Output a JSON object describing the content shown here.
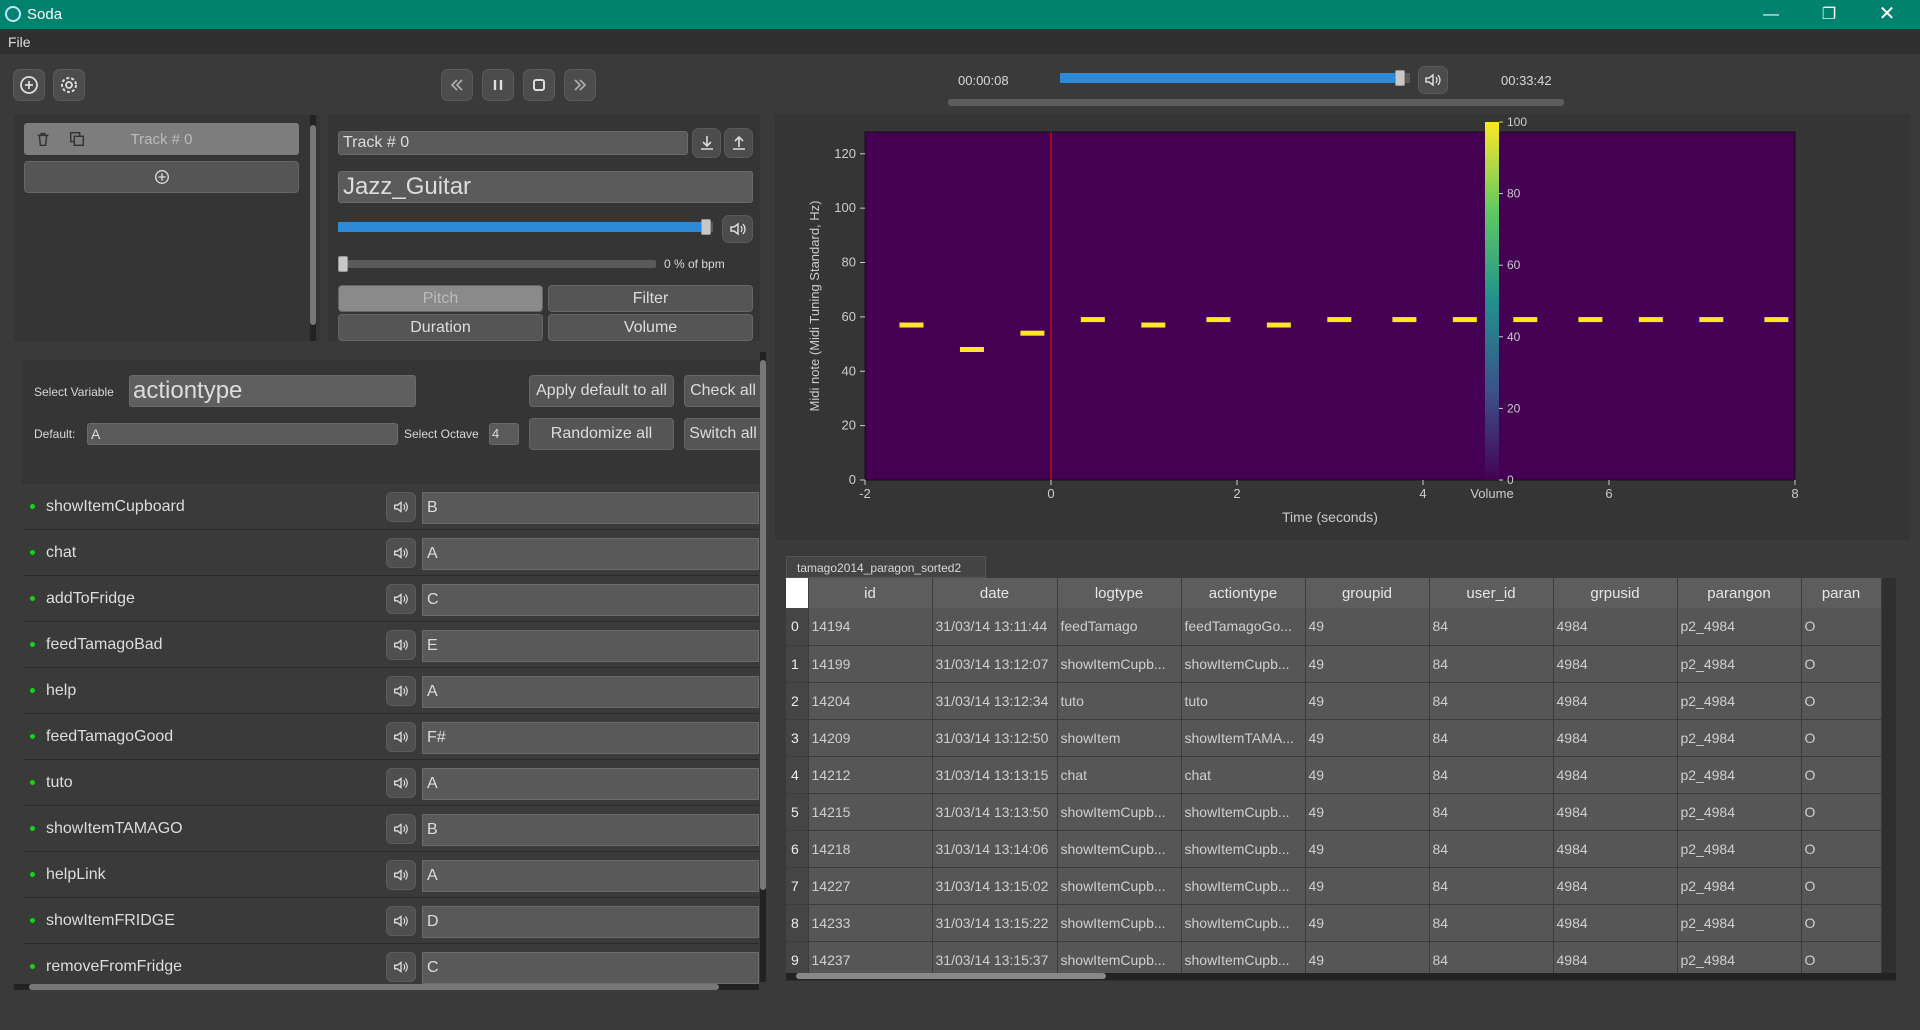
{
  "app": {
    "title": "Soda"
  },
  "menu": {
    "file": "File"
  },
  "transport": {
    "time_current": "00:00:08",
    "time_total": "00:33:42",
    "progress_fraction": 0.98
  },
  "tracks": {
    "items": [
      {
        "label": "Track # 0"
      }
    ]
  },
  "track_editor": {
    "track_name": "Track # 0",
    "instrument": "Jazz_Guitar",
    "volume_fraction": 0.99,
    "bpm_fraction": 0.0,
    "bpm_label": "0 % of bpm",
    "tabs": {
      "pitch": "Pitch",
      "filter": "Filter",
      "duration": "Duration",
      "volume": "Volume"
    }
  },
  "mapping": {
    "select_variable_label": "Select Variable",
    "select_variable_value": "actiontype",
    "default_label": "Default:",
    "default_value": "A",
    "select_octave_label": "Select Octave",
    "octave_value": "4",
    "apply_default_all": "Apply default to all",
    "check_all": "Check all",
    "randomize_all": "Randomize all",
    "switch_all": "Switch all",
    "rows": [
      {
        "label": "showItemCupboard",
        "value": "B"
      },
      {
        "label": "chat",
        "value": "A"
      },
      {
        "label": "addToFridge",
        "value": "C"
      },
      {
        "label": "feedTamagoBad",
        "value": "E"
      },
      {
        "label": "help",
        "value": "A"
      },
      {
        "label": "feedTamagoGood",
        "value": "F#"
      },
      {
        "label": "tuto",
        "value": "A"
      },
      {
        "label": "showItemTAMAGO",
        "value": "B"
      },
      {
        "label": "helpLink",
        "value": "A"
      },
      {
        "label": "showItemFRIDGE",
        "value": "D"
      },
      {
        "label": "removeFromFridge",
        "value": "C"
      }
    ]
  },
  "chart_data": {
    "type": "heatmap",
    "xlabel": "Time (seconds)",
    "ylabel": "Midi note (Midi Tuning Standard, Hz)",
    "xlim": [
      -2,
      8
    ],
    "ylim": [
      0,
      128
    ],
    "xticks": [
      "-2",
      "0",
      "2",
      "4",
      "6",
      "8"
    ],
    "yticks": [
      "0",
      "20",
      "40",
      "60",
      "80",
      "100",
      "120"
    ],
    "playhead_x": 0,
    "colorbar": {
      "label": "Volume",
      "ticks": [
        "0",
        "20",
        "40",
        "60",
        "80",
        "100"
      ],
      "range": [
        0,
        100
      ]
    },
    "colors": {
      "background": "#440154",
      "note": "#fde725",
      "playhead": "#b01010"
    },
    "notes": [
      {
        "t": -1.5,
        "pitch": 57,
        "volume": 100
      },
      {
        "t": -0.85,
        "pitch": 48,
        "volume": 100
      },
      {
        "t": -0.2,
        "pitch": 54,
        "volume": 100
      },
      {
        "t": 0.45,
        "pitch": 59,
        "volume": 100
      },
      {
        "t": 1.1,
        "pitch": 57,
        "volume": 100
      },
      {
        "t": 1.8,
        "pitch": 59,
        "volume": 100
      },
      {
        "t": 2.45,
        "pitch": 57,
        "volume": 100
      },
      {
        "t": 3.1,
        "pitch": 59,
        "volume": 100
      },
      {
        "t": 3.8,
        "pitch": 59,
        "volume": 100
      },
      {
        "t": 4.45,
        "pitch": 59,
        "volume": 100
      },
      {
        "t": 5.1,
        "pitch": 59,
        "volume": 100
      },
      {
        "t": 5.8,
        "pitch": 59,
        "volume": 100
      },
      {
        "t": 6.45,
        "pitch": 59,
        "volume": 100
      },
      {
        "t": 7.1,
        "pitch": 59,
        "volume": 100
      },
      {
        "t": 7.8,
        "pitch": 59,
        "volume": 100
      }
    ]
  },
  "dataset": {
    "tab": "tamago2014_paragon_sorted2",
    "columns": [
      "id",
      "date",
      "logtype",
      "actiontype",
      "groupid",
      "user_id",
      "grpusid",
      "parangon",
      "paran"
    ],
    "rows": [
      [
        "0",
        "14194",
        "31/03/14 13:11:44",
        "feedTamago",
        "feedTamagoGo...",
        "49",
        "84",
        "4984",
        "p2_4984",
        "O"
      ],
      [
        "1",
        "14199",
        "31/03/14 13:12:07",
        "showItemCupb...",
        "showItemCupb...",
        "49",
        "84",
        "4984",
        "p2_4984",
        "O"
      ],
      [
        "2",
        "14204",
        "31/03/14 13:12:34",
        "tuto",
        "tuto",
        "49",
        "84",
        "4984",
        "p2_4984",
        "O"
      ],
      [
        "3",
        "14209",
        "31/03/14 13:12:50",
        "showItem",
        "showItemTAMA...",
        "49",
        "84",
        "4984",
        "p2_4984",
        "O"
      ],
      [
        "4",
        "14212",
        "31/03/14 13:13:15",
        "chat",
        "chat",
        "49",
        "84",
        "4984",
        "p2_4984",
        "O"
      ],
      [
        "5",
        "14215",
        "31/03/14 13:13:50",
        "showItemCupb...",
        "showItemCupb...",
        "49",
        "84",
        "4984",
        "p2_4984",
        "O"
      ],
      [
        "6",
        "14218",
        "31/03/14 13:14:06",
        "showItemCupb...",
        "showItemCupb...",
        "49",
        "84",
        "4984",
        "p2_4984",
        "O"
      ],
      [
        "7",
        "14227",
        "31/03/14 13:15:02",
        "showItemCupb...",
        "showItemCupb...",
        "49",
        "84",
        "4984",
        "p2_4984",
        "O"
      ],
      [
        "8",
        "14233",
        "31/03/14 13:15:22",
        "showItemCupb...",
        "showItemCupb...",
        "49",
        "84",
        "4984",
        "p2_4984",
        "O"
      ],
      [
        "9",
        "14237",
        "31/03/14 13:15:37",
        "showItemCupb...",
        "showItemCupb...",
        "49",
        "84",
        "4984",
        "p2_4984",
        "O"
      ]
    ]
  }
}
